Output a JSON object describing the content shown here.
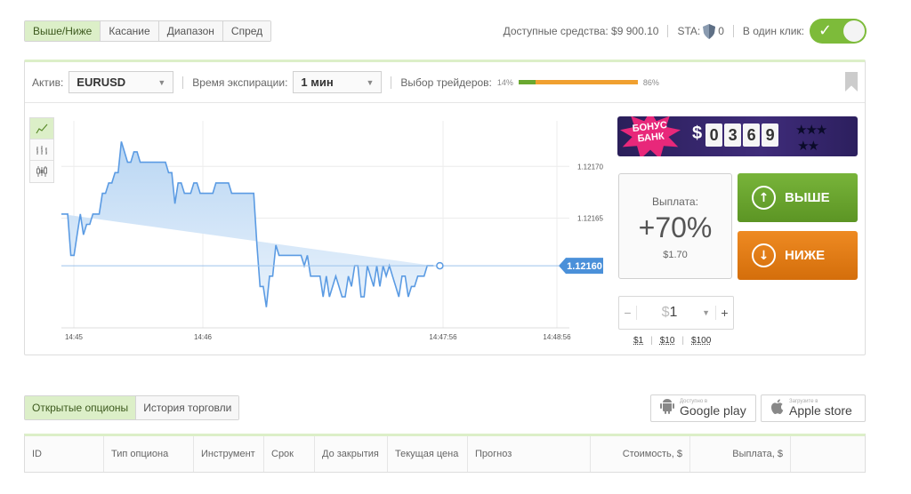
{
  "top_tabs": [
    {
      "label": "Выше/Ниже",
      "active": true
    },
    {
      "label": "Касание",
      "active": false
    },
    {
      "label": "Диапазон",
      "active": false
    },
    {
      "label": "Спред",
      "active": false
    }
  ],
  "account": {
    "funds_label": "Доступные средства: $9 900.10",
    "sta_label": "STA:",
    "sta_value": "0",
    "one_click_label": "В один клик:",
    "one_click_on": true
  },
  "toolbar": {
    "asset_label": "Актив:",
    "asset_value": "EURUSD",
    "expiry_label": "Время экспирации:",
    "expiry_value": "1 мин",
    "traders_label": "Выбор трейдеров:",
    "traders_up_pct": "14%",
    "traders_down_pct": "86%",
    "traders_up_fraction": 0.14
  },
  "chart_tools": [
    "line-chart-icon",
    "bar-chart-icon",
    "candlestick-icon"
  ],
  "chart_data": {
    "type": "area",
    "x_ticks": [
      "14:45",
      "14:46",
      "14:47:56",
      "14:48:56"
    ],
    "y_ticks": [
      "1.12170",
      "1.12165"
    ],
    "current_price": "1.12160",
    "x": [
      0,
      2,
      3,
      4,
      5,
      6,
      7,
      8,
      9,
      10,
      11,
      12,
      13,
      14,
      15,
      16,
      17,
      18,
      19,
      20,
      21,
      22,
      23,
      24,
      25,
      26,
      27,
      28,
      29,
      30,
      31,
      32,
      33,
      34,
      35,
      36,
      37,
      38,
      39,
      40,
      41,
      42,
      43,
      44,
      45,
      46,
      47,
      48,
      49,
      50,
      51,
      52,
      53,
      54,
      55,
      56,
      57,
      58,
      59,
      60,
      61,
      62,
      63,
      64,
      65,
      66,
      67,
      68,
      69,
      70,
      71,
      72,
      73,
      74,
      75,
      76,
      77,
      78,
      79,
      80,
      81,
      82,
      83,
      84,
      85,
      86,
      87,
      88,
      89,
      90,
      91,
      92,
      93,
      94,
      95,
      96,
      97,
      98,
      99,
      100,
      101,
      102,
      103,
      104,
      105,
      106,
      107,
      108,
      109,
      110,
      111,
      112,
      113,
      114,
      115,
      116,
      117,
      118,
      119,
      120
    ],
    "y": [
      1.121654,
      1.121654,
      1.121614,
      1.121614,
      1.121634,
      1.121654,
      1.121634,
      1.121644,
      1.121644,
      1.121654,
      1.121654,
      1.121654,
      1.121674,
      1.121674,
      1.121684,
      1.121684,
      1.121694,
      1.121694,
      1.121724,
      1.121714,
      1.121704,
      1.121704,
      1.121714,
      1.121714,
      1.121704,
      1.121704,
      1.121704,
      1.121704,
      1.121704,
      1.121704,
      1.121704,
      1.121704,
      1.121704,
      1.121694,
      1.121694,
      1.121664,
      1.121684,
      1.121684,
      1.121674,
      1.121674,
      1.121674,
      1.121684,
      1.121684,
      1.121674,
      1.121674,
      1.121674,
      1.121674,
      1.121674,
      1.121684,
      1.121684,
      1.121684,
      1.121684,
      1.121684,
      1.121674,
      1.121674,
      1.121674,
      1.121674,
      1.121674,
      1.121674,
      1.121674,
      1.121674,
      1.121624,
      1.121584,
      1.121584,
      1.121564,
      1.121594,
      1.121594,
      1.121624,
      1.121614,
      1.121614,
      1.121614,
      1.121614,
      1.121614,
      1.121614,
      1.121614,
      1.121614,
      1.121604,
      1.121614,
      1.121594,
      1.121594,
      1.121594,
      1.121594,
      1.121574,
      1.121594,
      1.121574,
      1.121584,
      1.121594,
      1.121584,
      1.121574,
      1.121574,
      1.121594,
      1.121584,
      1.121604,
      1.121604,
      1.121574,
      1.121574,
      1.121604,
      1.121594,
      1.121584,
      1.121604,
      1.121584,
      1.121604,
      1.121594,
      1.121604,
      1.121594,
      1.121584,
      1.121574,
      1.121594,
      1.121594,
      1.121574,
      1.121584,
      1.121584,
      1.121594,
      1.121594,
      1.121594,
      1.121604,
      1.121604,
      1.121604
    ],
    "ylim": [
      1.121544,
      1.121744
    ]
  },
  "bonus": {
    "line1": "БОНУС",
    "line2": "БАНК",
    "currency": "$",
    "digits": [
      "0",
      "3",
      "6",
      "9"
    ]
  },
  "payout": {
    "label": "Выплата:",
    "percent": "+70%",
    "amount": "$1.70"
  },
  "buttons": {
    "up": "ВЫШЕ",
    "down": "НИЖЕ"
  },
  "stake": {
    "minus": "−",
    "currency": "$",
    "value": "1",
    "plus": "+",
    "quick": [
      "$1",
      "$10",
      "$100"
    ]
  },
  "bottom_tabs": [
    {
      "label": "Открытые опционы",
      "active": true
    },
    {
      "label": "История торговли",
      "active": false
    }
  ],
  "stores": {
    "google": {
      "small": "Доступно в",
      "big": "Google play"
    },
    "apple": {
      "small": "Загрузите в",
      "big": "Apple store"
    }
  },
  "table_headers": [
    "ID",
    "Тип опциона",
    "Инструмент",
    "Срок",
    "До закрытия",
    "Текущая цена",
    "Прогноз",
    "Стоимость, $",
    "Выплата, $",
    ""
  ],
  "colors": {
    "accent_green": "#7dbb3a",
    "accent_orange": "#ee8a22",
    "line_blue": "#5b9be3"
  }
}
